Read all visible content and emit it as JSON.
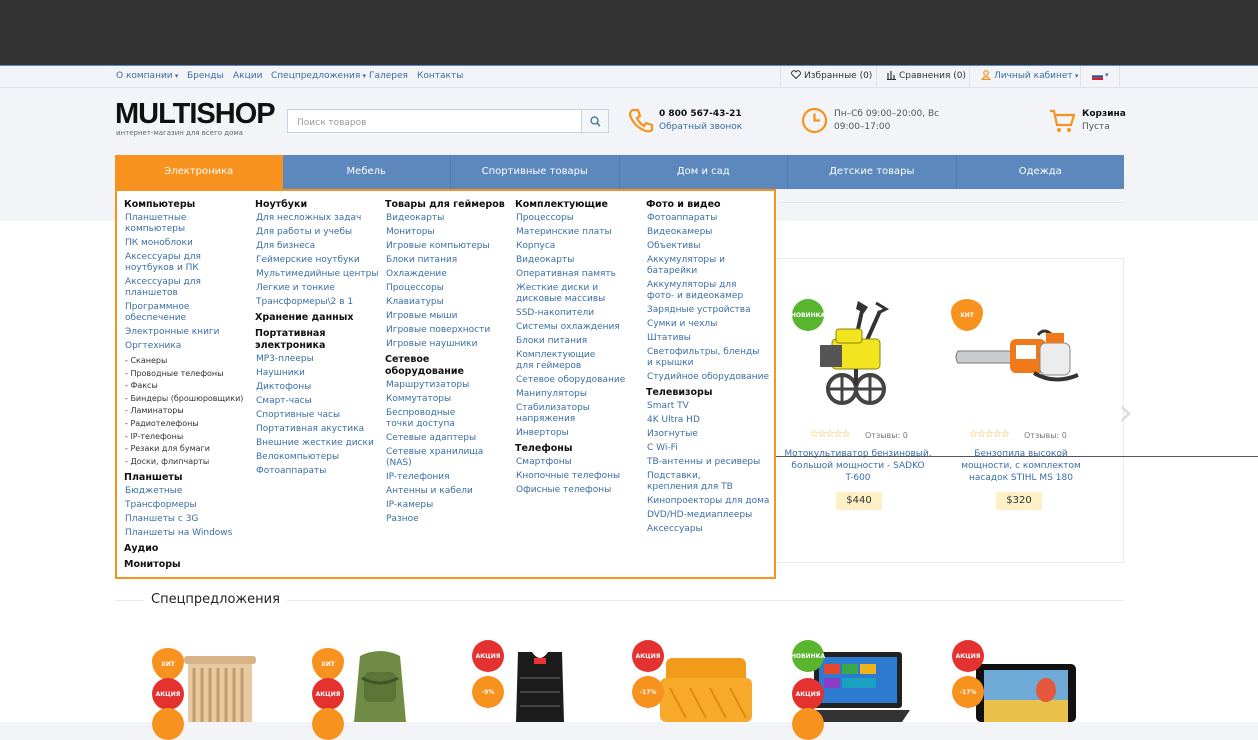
{
  "topbar": {
    "left_links": [
      "О компании",
      "Бренды",
      "Акции",
      "Спецпредложения",
      "Галерея",
      "Контакты"
    ],
    "favorites": "Избранные (0)",
    "compare": "Сравнения (0)",
    "account": "Личный кабинет"
  },
  "header": {
    "logo": "MULTISHOP",
    "tagline": "интернет-магазин для всего дома",
    "search_placeholder": "Поиск товаров",
    "phone": "0 800 567-43-21",
    "callback": "Обратный звонок",
    "hours_line1": "Пн–Сб 09:00–20:00, Вс",
    "hours_line2": "09:00–17:00",
    "cart_label": "Корзина",
    "cart_status": "Пуста"
  },
  "nav": [
    "Электроника",
    "Мебель",
    "Спортивные товары",
    "Дом и сад",
    "Детские товары",
    "Одежда"
  ],
  "mega_menu": {
    "col1": {
      "h_computers": "Компьютеры",
      "computers": [
        "Планшетные компьютеры",
        "ПК моноблоки",
        "Аксессуары для ноутбуков и ПК",
        "Аксессуары для планшетов",
        "Программное обеспечение",
        "Электронные книги",
        "Оргтехника"
      ],
      "orgtech_sub": [
        "Сканеры",
        "Проводные телефоны",
        "Факсы",
        "Биндеры (брошюровщики)",
        "Ламинаторы",
        "Радиотелефоны",
        "IP-телефоны",
        "Резаки для бумаги",
        "Доски, флипчарты"
      ],
      "h_tablets": "Планшеты",
      "tablets": [
        "Бюджетные",
        "Трансформеры",
        "Планшеты с 3G",
        "Планшеты на Windows"
      ],
      "h_audio": "Аудио",
      "h_monitors": "Мониторы"
    },
    "col2": {
      "h_laptops": "Ноутбуки",
      "laptops": [
        "Для несложных задач",
        "Для работы и учебы",
        "Для бизнеса",
        "Геймерские ноутбуки",
        "Мультимедийные центры",
        "Легкие и тонкие",
        "Трансформеры\\2 в 1"
      ],
      "h_storage": "Хранение данных",
      "h_portable": "Портативная электроника",
      "portable": [
        "MP3-плееры",
        "Наушники",
        "Диктофоны",
        "Смарт-часы",
        "Спортивные часы",
        "Портативная акустика",
        "Внешние жесткие диски",
        "Велокомпьютеры",
        "Фотоаппараты"
      ]
    },
    "col3": {
      "h_gamers": "Товары для геймеров",
      "gamers": [
        "Видеокарты",
        "Мониторы",
        "Игровые компьютеры",
        "Блоки питания",
        "Охлаждение",
        "Процессоры",
        "Клавиатуры",
        "Игровые мыши",
        "Игровые поверхности",
        "Игровые наушники"
      ],
      "h_network": "Сетевое оборудование",
      "network": [
        "Маршрутизаторы",
        "Коммутаторы",
        "Беспроводные точки доступа",
        "Сетевые адаптеры",
        "Сетевые хранилища (NAS)",
        "IP-телефония",
        "Антенны и кабели",
        "IP-камеры",
        "Разное"
      ]
    },
    "col4": {
      "h_components": "Комплектующие",
      "components": [
        "Процессоры",
        "Материнские платы",
        "Корпуса",
        "Видеокарты",
        "Оперативная память",
        "Жесткие диски и дисковые массивы",
        "SSD-накопители",
        "Системы охлаждения",
        "Блоки питания",
        "Комплектующие для геймеров",
        "Сетевое оборудование",
        "Манипуляторы",
        "Стабилизаторы напряжения",
        "Инверторы"
      ],
      "h_phones": "Телефоны",
      "phones": [
        "Смартфоны",
        "Кнопочные телефоны",
        "Офисные телефоны"
      ]
    },
    "col5": {
      "h_photo": "Фото и видео",
      "photo": [
        "Фотоаппараты",
        "Видеокамеры",
        "Объективы",
        "Аккумуляторы и батарейки",
        "Аккумуляторы для фото- и видеокамер",
        "Зарядные устройства",
        "Сумки и чехлы",
        "Штативы",
        "Светофильтры, бленды и крышки",
        "Студийное оборудование"
      ],
      "h_tv": "Телевизоры",
      "tv": [
        "Smart TV",
        "4K Ultra HD",
        "Изогнутые",
        "С Wi-Fi",
        "ТВ-антенны и ресиверы",
        "Подставки, крепления для ТВ",
        "Кинопроекторы для дома",
        "DVD/HD-медиаплееры",
        "Аксессуары"
      ]
    }
  },
  "products": [
    {
      "badge": "НОВИНКА",
      "title_l1": "Мотокультиватор бензиновый,",
      "title_l2": "большой мощности - SADKO",
      "title_l3": "T-600",
      "reviews": "Отзывы: 0",
      "price": "$440"
    },
    {
      "badge": "ХИТ",
      "title_l1": "Бензопила высокой",
      "title_l2": "мощности, с комплектом",
      "title_l3": "насадок STIHL MS 180",
      "reviews": "Отзывы: 0",
      "price": "$320"
    }
  ],
  "special": {
    "title": "Спецпредложения",
    "badges": [
      "ХИТ",
      "АКЦИЯ",
      "ХИТ",
      "АКЦИЯ",
      "АКЦИЯ",
      "-9%",
      "АКЦИЯ",
      "-17%",
      "НОВИНКА",
      "АКЦИЯ",
      "АКЦИЯ",
      "-17%"
    ]
  },
  "colors": {
    "accent": "#f7921e",
    "nav": "#5c88be",
    "link": "#3a6ea5",
    "new": "#5ab52e",
    "sale": "#e3322f"
  }
}
